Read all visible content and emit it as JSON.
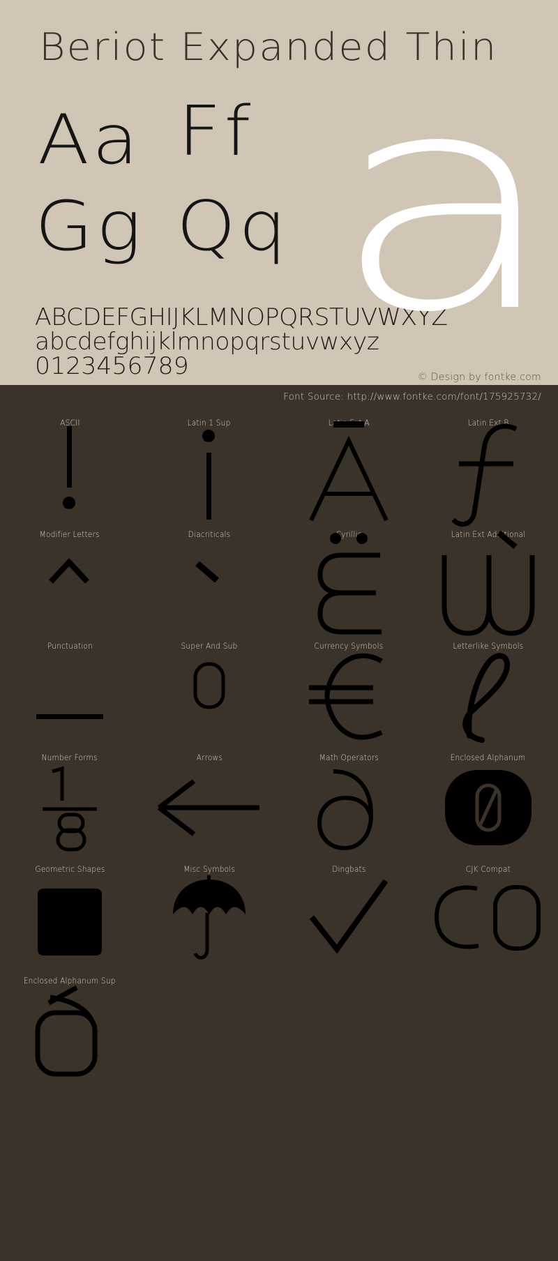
{
  "theme": {
    "page_background": "#d1c6b5",
    "dark_panel_background": "#3b3229",
    "title_color": "#3a3128",
    "glyph_color": "#000000",
    "hero_glyph_color": "#ffffff",
    "label_color": "#d6cdc0",
    "copyright_color": "#59503f"
  },
  "specimen": {
    "title": "Beriot Expanded Thin",
    "hero_letter": "a",
    "letter_pairs": [
      {
        "name": "aa",
        "text": "Aa"
      },
      {
        "name": "ff",
        "text": "Ff"
      },
      {
        "name": "gg",
        "text": "Gg"
      },
      {
        "name": "qq",
        "text": "Qq"
      }
    ],
    "uppercase": "ABCDEFGHIJKLMNOPQRSTUVWXYZ",
    "lowercase": "abcdefghijklmnopqrstuvwxyz",
    "digits": "0123456789",
    "copyright": "© Design by fontke.com"
  },
  "source_bar": {
    "text": "Font Source: http://www.fontke.com/font/175925732/"
  },
  "unicode_blocks": [
    {
      "label": "ASCII",
      "glyph": "!",
      "glyph_name": "exclamation-mark-glyph"
    },
    {
      "label": "Latin 1 Sup",
      "glyph": "¡",
      "glyph_name": "inverted-exclamation-glyph"
    },
    {
      "label": "Latin Ext A",
      "glyph": "Ā",
      "glyph_name": "a-macron-glyph"
    },
    {
      "label": "Latin Ext B",
      "glyph": "ƒ",
      "glyph_name": "florin-glyph"
    },
    {
      "label": "Modifier Letters",
      "glyph": "ˆ",
      "glyph_name": "circumflex-modifier-glyph"
    },
    {
      "label": "Diacriticals",
      "glyph": "`",
      "glyph_name": "grave-accent-glyph"
    },
    {
      "label": "Cyrillic",
      "glyph": "Ё",
      "glyph_name": "cyrillic-yo-glyph"
    },
    {
      "label": "Latin Ext Additional",
      "glyph": "Ẁ",
      "glyph_name": "w-grave-glyph"
    },
    {
      "label": "Punctuation",
      "glyph": "—",
      "glyph_name": "em-dash-glyph"
    },
    {
      "label": "Super And Sub",
      "glyph": "⁰",
      "glyph_name": "superscript-zero-glyph"
    },
    {
      "label": "Currency Symbols",
      "glyph": "€",
      "glyph_name": "euro-sign-glyph"
    },
    {
      "label": "Letterlike Symbols",
      "glyph": "ℓ",
      "glyph_name": "script-small-l-glyph"
    },
    {
      "label": "Number Forms",
      "glyph": "⅛",
      "glyph_name": "one-eighth-fraction-glyph"
    },
    {
      "label": "Arrows",
      "glyph": "←",
      "glyph_name": "left-arrow-glyph"
    },
    {
      "label": "Math Operators",
      "glyph": "∂",
      "glyph_name": "partial-differential-glyph"
    },
    {
      "label": "Enclosed Alphanum",
      "glyph": "⓪",
      "glyph_name": "circled-zero-glyph"
    },
    {
      "label": "Geometric Shapes",
      "glyph": "■",
      "glyph_name": "black-square-glyph"
    },
    {
      "label": "Misc Symbols",
      "glyph": "☂",
      "glyph_name": "umbrella-glyph"
    },
    {
      "label": "Dingbats",
      "glyph": "✓",
      "glyph_name": "check-mark-glyph"
    },
    {
      "label": "CJK Compat",
      "glyph": "㏇",
      "glyph_name": "cjk-square-co-glyph"
    },
    {
      "label": "Enclosed Alphanum Sup",
      "glyph": "🄋",
      "glyph_name": "enclosed-alphanum-sup-glyph"
    }
  ]
}
